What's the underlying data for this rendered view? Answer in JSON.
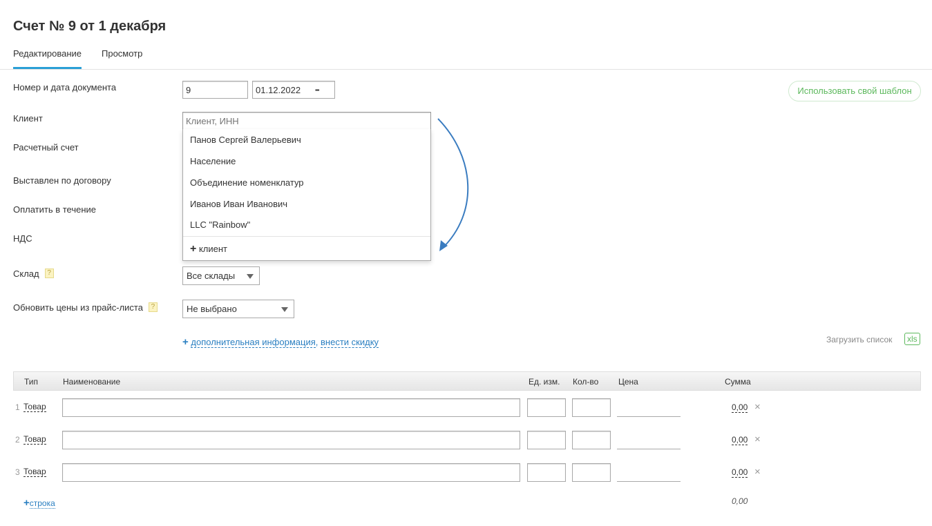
{
  "title": "Счет № 9 от 1 декабря",
  "tabs": [
    {
      "label": "Редактирование"
    },
    {
      "label": "Просмотр"
    }
  ],
  "template_button": "Использовать свой шаблон",
  "form": {
    "doc_label": "Номер и дата документа",
    "doc_number": "9",
    "doc_date": "01.12.2022",
    "client_label": "Клиент",
    "client_placeholder": "Клиент, ИНН",
    "account_label": "Расчетный счет",
    "contract_label": "Выставлен по договору",
    "pay_label": "Оплатить в течение",
    "vat_label": "НДС",
    "warehouse_label": "Склад",
    "warehouse_value": "Все склады",
    "prices_label": "Обновить цены из прайс-листа",
    "prices_value": "Не выбрано",
    "help": "?",
    "extra_plus": "+",
    "extra_info": "дополнительная информация",
    "extra_comma": ",",
    "discount": "внести скидку"
  },
  "dropdown": {
    "items": [
      "Панов Сергей Валерьевич",
      "Население",
      "Объединение номенклатур",
      "Иванов Иван Иванович",
      "LLC \"Rainbow\""
    ],
    "add_plus": "+",
    "add_label": "клиент"
  },
  "upload": {
    "label": "Загрузить список",
    "badge": "xls"
  },
  "table": {
    "headers": [
      "Тип",
      "Наименование",
      "Ед. изм.",
      "Кол-во",
      "Цена",
      "Сумма"
    ],
    "rows": [
      {
        "n": "1",
        "type": "Товар",
        "sum": "0,00"
      },
      {
        "n": "2",
        "type": "Товар",
        "sum": "0,00"
      },
      {
        "n": "3",
        "type": "Товар",
        "sum": "0,00"
      }
    ],
    "delete": "×",
    "add_plus": "+",
    "add_row": "строка",
    "total": "0,00"
  },
  "colors": {
    "accent": "#2a9fd6",
    "link": "#2a7fc1",
    "green": "#5cb85c"
  }
}
